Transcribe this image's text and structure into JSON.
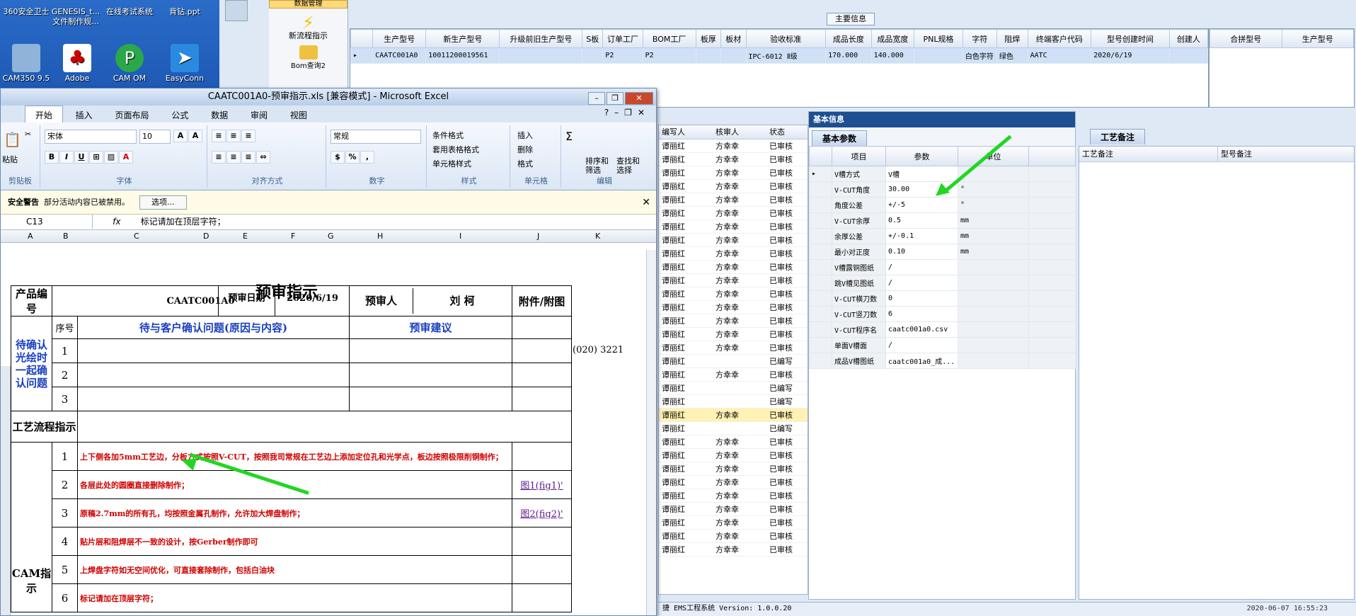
{
  "desktop": {
    "icons": [
      {
        "label": "360安全卫士"
      },
      {
        "label": "GENESIS_t... 文件制作规..."
      },
      {
        "label": "在线考试系统"
      },
      {
        "label": "背钻.ppt"
      },
      {
        "label": "CAM350 9.5"
      },
      {
        "label": "Adobe"
      },
      {
        "label": "CAM OM"
      },
      {
        "label": "EasyConn"
      }
    ]
  },
  "ems": {
    "menu_header": "数据管理",
    "new_flow": "新流程指示",
    "bom_query": "Bom查询2",
    "main_info_title": "主要信息",
    "main_headers": [
      "生产型号",
      "新生产型号",
      "升级前旧生产型号",
      "S板",
      "订单工厂",
      "BOM工厂",
      "板厚",
      "板材",
      "验收标准",
      "成品长度",
      "成品宽度",
      "PNL规格",
      "字符",
      "阻焊",
      "终端客户代码",
      "型号创建时间",
      "创建人"
    ],
    "main_row": [
      "CAATC001A0",
      "10011200019561",
      "",
      "",
      "P2",
      "P2",
      "",
      "",
      "IPC-6012 Ⅱ级",
      "170.000",
      "140.000",
      "",
      "白色字符",
      "绿色",
      "AATC",
      "2020/6/19",
      ""
    ],
    "right_headers": [
      "合拼型号",
      "生产型号"
    ],
    "mid_headers": [
      "编写人",
      "核审人",
      "状态"
    ],
    "mid_rows": [
      [
        "谭丽红",
        "方幸幸",
        "已审核"
      ],
      [
        "谭丽红",
        "方幸幸",
        "已审核"
      ],
      [
        "谭丽红",
        "方幸幸",
        "已审核"
      ],
      [
        "谭丽红",
        "方幸幸",
        "已审核"
      ],
      [
        "谭丽红",
        "方幸幸",
        "已审核"
      ],
      [
        "谭丽红",
        "方幸幸",
        "已审核"
      ],
      [
        "谭丽红",
        "方幸幸",
        "已审核"
      ],
      [
        "谭丽红",
        "方幸幸",
        "已审核"
      ],
      [
        "谭丽红",
        "方幸幸",
        "已审核"
      ],
      [
        "谭丽红",
        "方幸幸",
        "已审核"
      ],
      [
        "谭丽红",
        "方幸幸",
        "已审核"
      ],
      [
        "谭丽红",
        "方幸幸",
        "已审核"
      ],
      [
        "谭丽红",
        "方幸幸",
        "已审核"
      ],
      [
        "谭丽红",
        "方幸幸",
        "已审核"
      ],
      [
        "谭丽红",
        "方幸幸",
        "已审核"
      ],
      [
        "谭丽红",
        "方幸幸",
        "已审核"
      ],
      [
        "谭丽红",
        "",
        "已编写"
      ],
      [
        "谭丽红",
        "方幸幸",
        "已审核"
      ],
      [
        "谭丽红",
        "",
        "已编写"
      ],
      [
        "谭丽红",
        "",
        "已编写"
      ],
      [
        "谭丽红",
        "方幸幸",
        "已审核"
      ],
      [
        "谭丽红",
        "",
        "已编写"
      ],
      [
        "谭丽红",
        "方幸幸",
        "已审核"
      ],
      [
        "谭丽红",
        "方幸幸",
        "已审核"
      ],
      [
        "谭丽红",
        "方幸幸",
        "已审核"
      ],
      [
        "谭丽红",
        "方幸幸",
        "已审核"
      ],
      [
        "谭丽红",
        "方幸幸",
        "已审核"
      ],
      [
        "谭丽红",
        "方幸幸",
        "已审核"
      ],
      [
        "谭丽红",
        "方幸幸",
        "已审核"
      ],
      [
        "谭丽红",
        "方幸幸",
        "已审核"
      ],
      [
        "谭丽红",
        "方幸幸",
        "已审核"
      ]
    ],
    "basic_title": "基本信息",
    "basic_tab": "基本参数",
    "craft_tab": "工艺备注",
    "param_headers": [
      "项目",
      "参数",
      "单位"
    ],
    "params": [
      [
        "V槽方式",
        "V槽",
        ""
      ],
      [
        "V-CUT角度",
        "30.00",
        "°"
      ],
      [
        "角度公差",
        "+/-5",
        "°"
      ],
      [
        "V-CUT余厚",
        "0.5",
        "mm"
      ],
      [
        "余厚公差",
        "+/-0.1",
        "mm"
      ],
      [
        "最小对正度",
        "0.10",
        "mm"
      ],
      [
        "V槽露铜图纸",
        "/",
        ""
      ],
      [
        "跳V槽见图纸",
        "/",
        ""
      ],
      [
        "V-CUT横刀数",
        "0",
        ""
      ],
      [
        "V-CUT竖刀数",
        "6",
        ""
      ],
      [
        "V-CUT程序名",
        "caatc001a0.csv",
        ""
      ],
      [
        "单面V槽面",
        "/",
        ""
      ],
      [
        "成品V槽图纸",
        "caatc001a0_成...",
        ""
      ]
    ],
    "craft_headers": [
      "工艺备注",
      "型号备注"
    ],
    "status_text": "捷 EMS工程系统 Version: 1.0.0.20",
    "clock": "2020-06-07 16:55:23"
  },
  "excel": {
    "title": "CAATC001A0-预审指示.xls  [兼容模式] - Microsoft Excel",
    "tabs": [
      "开始",
      "插入",
      "页面布局",
      "公式",
      "数据",
      "审阅",
      "视图"
    ],
    "font_name": "宋体",
    "font_size": "10",
    "number_format": "常规",
    "groups": [
      "剪贴板",
      "字体",
      "对齐方式",
      "数字",
      "样式",
      "单元格",
      "编辑"
    ],
    "paste": "粘贴",
    "styles": [
      "条件格式",
      "套用表格格式",
      "单元格样式"
    ],
    "cells_btns": [
      "插入",
      "删除",
      "格式"
    ],
    "edit_btns": [
      "排序和筛选",
      "查找和选择"
    ],
    "security_label": "安全警告",
    "security_text": "部分活动内容已被禁用。",
    "options_btn": "选项...",
    "cell_ref": "C13",
    "formula": "标记请加在顶层字符；",
    "cols": [
      "A",
      "B",
      "C",
      "D",
      "E",
      "F",
      "G",
      "H",
      "I",
      "J",
      "K"
    ],
    "rownums": [
      "",
      "",
      "",
      "",
      "",
      "",
      "",
      "",
      "",
      "0",
      "1",
      "2",
      "3"
    ],
    "sheet": {
      "title": "预审指示",
      "product_label": "产品编号",
      "product_no": "CAATC001A0",
      "date_label": "预审日期",
      "date": "2020/6/19",
      "reviewer_label": "预审人",
      "reviewer": "刘 柯",
      "attach_label": "附件/附图",
      "phone": "(020) 3221",
      "seq": "序号",
      "issue": "待与客户确认问题(原因与内容)",
      "advice": "预审建议",
      "confirm": "待确认光绘时一起确认问题",
      "n1": "1",
      "n2": "2",
      "n3": "3",
      "flow": "工艺流程指示",
      "cam": "CAM指示",
      "items": [
        {
          "n": "1",
          "t": "上下侧各加5mm工艺边，分板方式按照V-CUT，按照我司常规在工艺边上添加定位孔和光学点，板边按照极限削铜制作；",
          "a": ""
        },
        {
          "n": "2",
          "t": "各层此处的圆圈直接删除制作；",
          "a": "图1(fig1)'"
        },
        {
          "n": "3",
          "t": "原稿2.7mm的所有孔，均按照金属孔制作，允许加大焊盘制作；",
          "a": "图2(fig2)'"
        },
        {
          "n": "4",
          "t": "贴片层和阻焊层不一致的设计，按Gerber制作即可",
          "a": ""
        },
        {
          "n": "5",
          "t": "上焊盘字符如无空间优化，可直接套除制作，包括白油块",
          "a": ""
        },
        {
          "n": "6",
          "t": "标记请加在顶层字符；",
          "a": ""
        }
      ]
    }
  }
}
